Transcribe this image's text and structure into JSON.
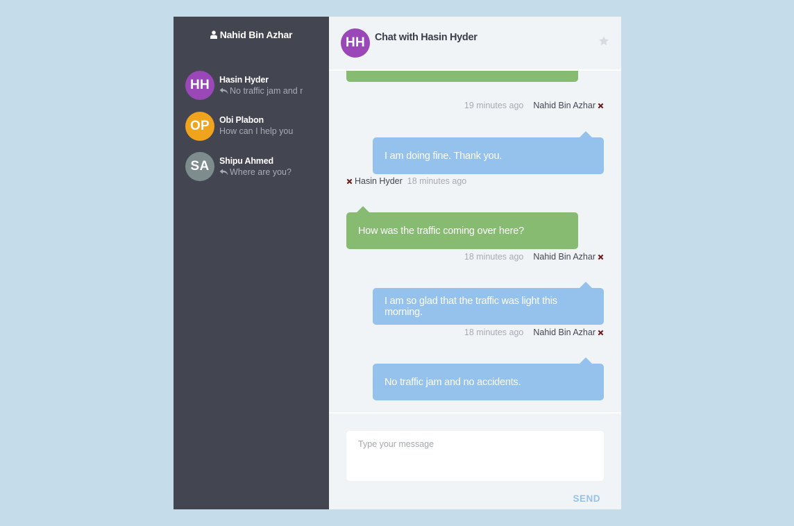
{
  "current_user": {
    "name": "Nahid Bin Azhar",
    "icon": "user-icon"
  },
  "contacts": [
    {
      "initials": "HH",
      "name": "Hasin Hyder",
      "preview": "No traffic jam and n",
      "reply_icon": true,
      "avatar_color": "#9a47b8"
    },
    {
      "initials": "OP",
      "name": "Obi Plabon",
      "preview": "How can I help you",
      "reply_icon": false,
      "avatar_color": "#f0a31c"
    },
    {
      "initials": "SA",
      "name": "Shipu Ahmed",
      "preview": "Where are you?",
      "reply_icon": true,
      "avatar_color": "#7f8c8d"
    }
  ],
  "chat": {
    "title": "Chat with Hasin Hyder",
    "avatar_initials": "HH",
    "avatar_color": "#9a47b8",
    "star_icon": "star-icon",
    "messages": [
      {
        "from": "Nahid Bin Azhar",
        "time": "19 minutes ago",
        "text": "I am doing fine. Thank you.",
        "side": "right"
      },
      {
        "from": "Hasin Hyder",
        "time": "18 minutes ago",
        "text": "How was the traffic coming over here?",
        "side": "left"
      },
      {
        "from": "Nahid Bin Azhar",
        "time": "18 minutes ago",
        "text": "I am so glad that the traffic was light this morning.",
        "side": "right"
      },
      {
        "from": "Nahid Bin Azhar",
        "time": "18 minutes ago",
        "text": "No traffic jam and no accidents.",
        "side": "right"
      }
    ]
  },
  "composer": {
    "placeholder": "Type your message",
    "send_label": "SEND"
  },
  "colors": {
    "background": "#c5dcea",
    "sidebar": "#434651",
    "chat_panel": "#f1f4f7",
    "bubble_self": "#94c2ed",
    "bubble_other": "#86bb71",
    "remove_mark": "#6e2020"
  }
}
